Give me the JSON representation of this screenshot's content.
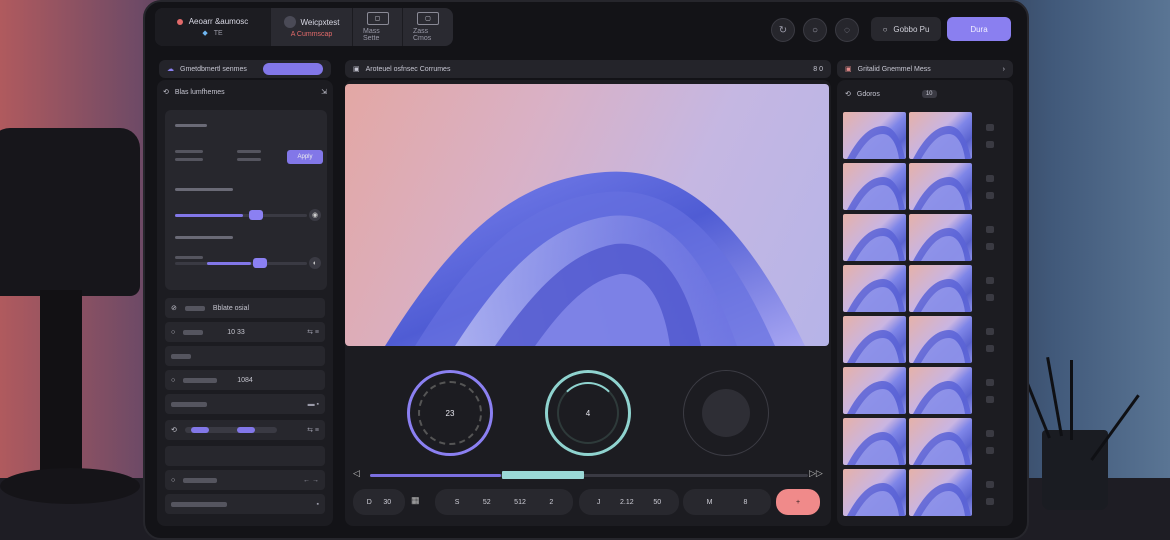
{
  "topbar": {
    "tabs": [
      {
        "title": "Aeoarr &aumosc",
        "sub": "TE",
        "icon": "gem-icon"
      },
      {
        "title": "Weicpxtest",
        "sub": "A Cummscap",
        "icon": "badge-icon"
      },
      {
        "title": "",
        "sub": "Mass  Sette",
        "icon": "box-icon"
      },
      {
        "title": "",
        "sub": "Zass  Cmos",
        "icon": "box-icon"
      }
    ],
    "button_dark_label": "Gobbo Pu",
    "button_primary_label": "Dura"
  },
  "left": {
    "header": "Gmetdbmertl senmes",
    "subheader": "Blas lumfhemes",
    "button_label": "Apply",
    "rows": [
      {
        "label": "Bblate osial",
        "value": ""
      },
      {
        "label": "",
        "value": "10 33"
      },
      {
        "label": "",
        "value": ""
      },
      {
        "label": "",
        "value": "1084"
      },
      {
        "label": "",
        "value": ""
      },
      {
        "label": "",
        "value": ""
      },
      {
        "label": "",
        "value": ""
      },
      {
        "label": "",
        "value": ""
      }
    ],
    "sliders": [
      0.52,
      0.58
    ]
  },
  "center": {
    "header": "Aroteuel osfnsec Corrumes",
    "header_right": "8 0",
    "dials": [
      {
        "label": "23"
      },
      {
        "label": "4"
      },
      {
        "label": ""
      }
    ],
    "timeline_progress": 0.3,
    "controls": [
      {
        "items": [
          "D",
          "30"
        ]
      },
      {
        "items": [
          "S",
          "52",
          "512",
          "2"
        ]
      },
      {
        "items": [
          "J",
          "2.12",
          "50"
        ]
      },
      {
        "items": [
          "M",
          "8"
        ]
      },
      {
        "items": [
          "+"
        ]
      }
    ]
  },
  "right": {
    "header": "Gritalid Gnemmel Mess",
    "subheader": "Gdoros",
    "badge": "10",
    "thumb_rows": 8
  },
  "colors": {
    "accent": "#8a7ff0",
    "accent_red": "#f08a8a",
    "teal": "#9ad8d6",
    "panel": "#1c1c21"
  }
}
